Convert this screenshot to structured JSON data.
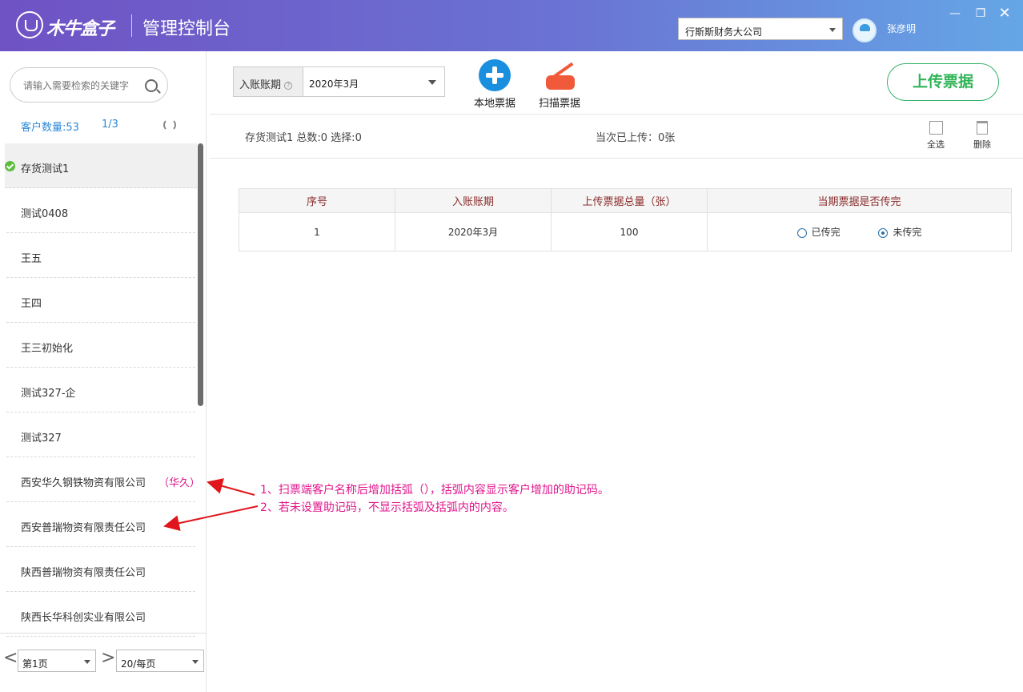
{
  "header": {
    "logo_text": "木牛盒子",
    "title": "管理控制台",
    "company": "行斯斯财务大公司",
    "user": "张彦明",
    "window_controls": {
      "minimize": "—",
      "restore": "❐",
      "close": "✕"
    }
  },
  "sidebar": {
    "search_placeholder": "请输入需要检索的关键字",
    "customer_count": "客户数量:53",
    "page_indicator": "1/3",
    "customers": [
      {
        "name": "存货测试1",
        "alias": "",
        "active": true
      },
      {
        "name": "测试0408",
        "alias": ""
      },
      {
        "name": "王五",
        "alias": ""
      },
      {
        "name": "王四",
        "alias": ""
      },
      {
        "name": "王三初始化",
        "alias": ""
      },
      {
        "name": "测试327-企",
        "alias": ""
      },
      {
        "name": "测试327",
        "alias": ""
      },
      {
        "name": "西安华久钢铁物资有限公司",
        "alias": "（华久）"
      },
      {
        "name": "西安普瑞物资有限责任公司",
        "alias": ""
      },
      {
        "name": "陕西普瑞物资有限责任公司",
        "alias": ""
      },
      {
        "name": "陕西长华科创实业有限公司",
        "alias": ""
      }
    ],
    "pager": {
      "prev": "<",
      "next": ">",
      "page": "第1页",
      "per_page": "20/每页"
    }
  },
  "toolbar": {
    "period_label": "入账账期",
    "period_help": "?",
    "period_value": "2020年3月",
    "local_upload": "本地票据",
    "scan_upload": "扫描票据",
    "upload_button": "上传票据"
  },
  "info": {
    "summary": "存货测试1 总数:0 选择:0",
    "uploaded": "当次已上传：0张",
    "select_all": "全选",
    "delete": "删除"
  },
  "table": {
    "headers": [
      "序号",
      "入账账期",
      "上传票据总量（张）",
      "当期票据是否传完"
    ],
    "rows": [
      {
        "index": "1",
        "period": "2020年3月",
        "total": "100",
        "option_done": "已传完",
        "option_pending": "未传完",
        "selected": "未传完"
      }
    ]
  },
  "annotations": {
    "line1": "1、扫票端客户名称后增加括弧（），括弧内容显示客户增加的助记码。",
    "line2": "2、若未设置助记码，不显示括弧及括弧内的内容。"
  },
  "colors": {
    "accent": "#2b88d8",
    "brand_gradient_start": "#6f52c4",
    "brand_gradient_end": "#65a6e6",
    "upload_green": "#2fb457",
    "annotation": "#e0168c"
  }
}
